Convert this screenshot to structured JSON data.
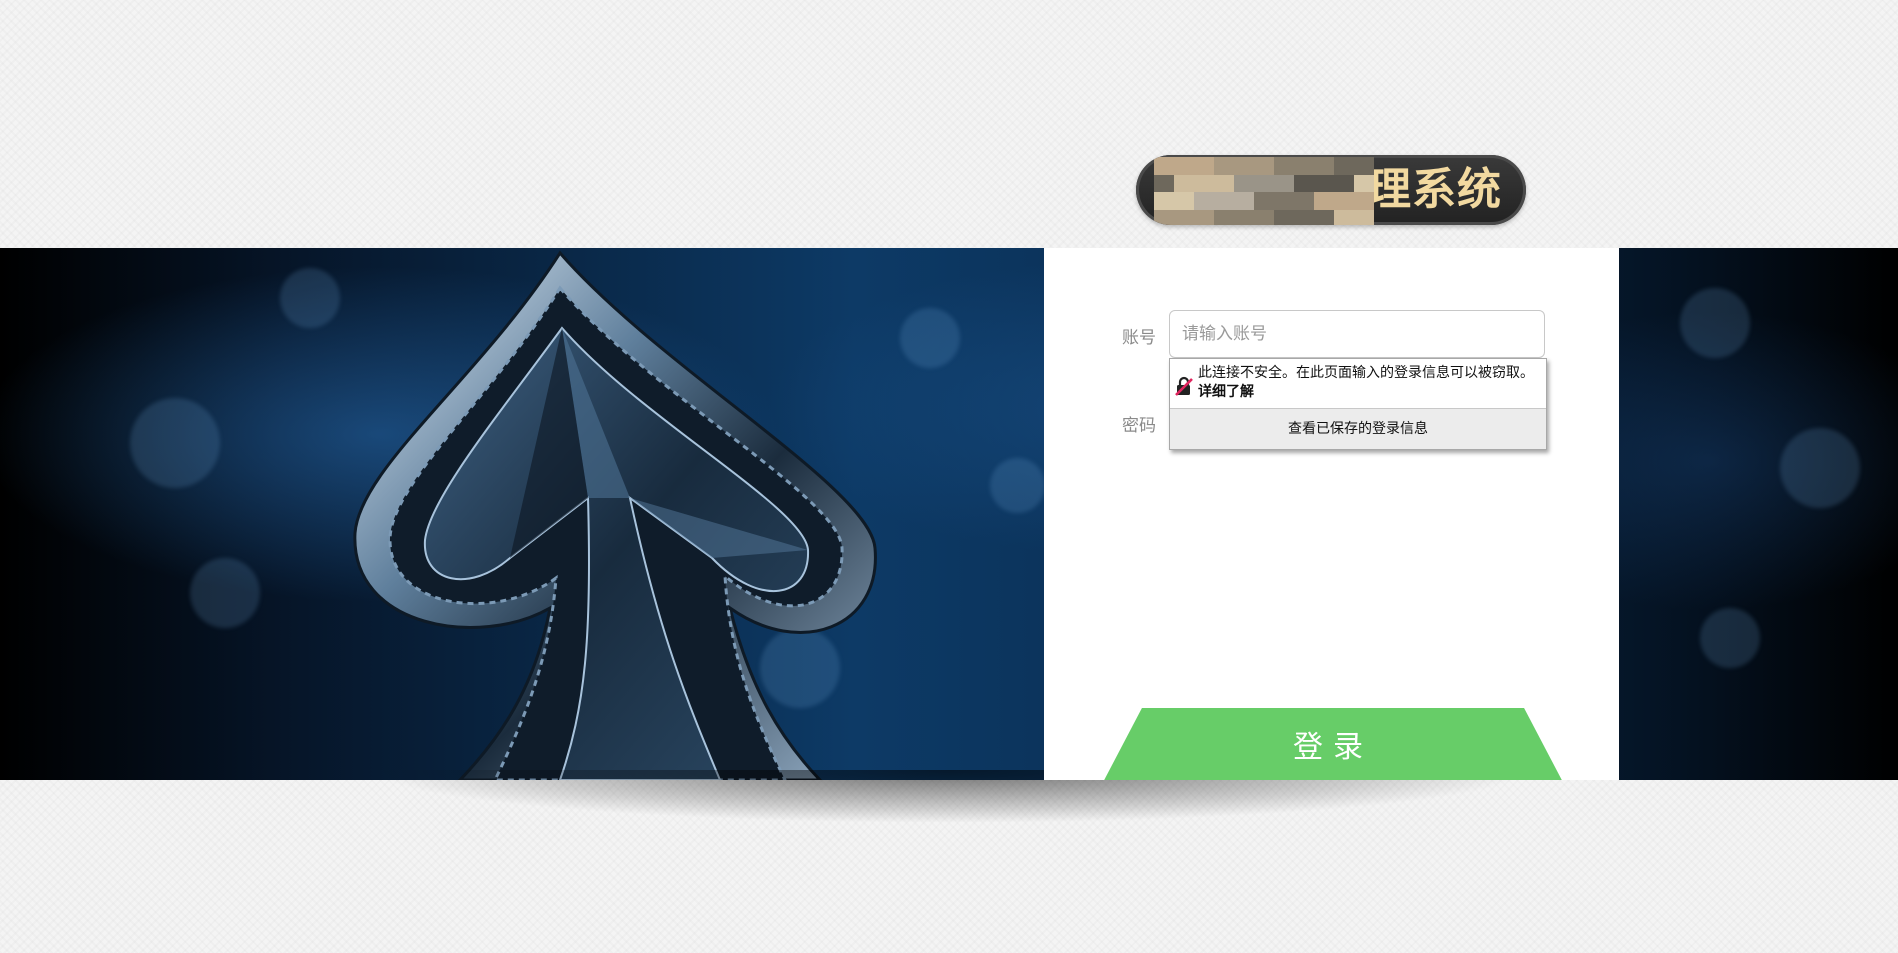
{
  "header": {
    "system_title": "理系统"
  },
  "login": {
    "account_label": "账号",
    "account_placeholder": "请输入账号",
    "account_value": "",
    "password_label": "密码",
    "submit_label": "登录"
  },
  "autofill_popup": {
    "warning_text": "此连接不安全。在此页面输入的登录信息可以被窃取。",
    "learn_more": "详细了解",
    "saved_logins": "查看已保存的登录信息"
  },
  "colors": {
    "login_button": "#67cd68",
    "logo_text": "#f2d9a0",
    "logo_pill": "#2e2e2e"
  },
  "icons": {
    "insecure_lock": "insecure-lock-icon"
  }
}
